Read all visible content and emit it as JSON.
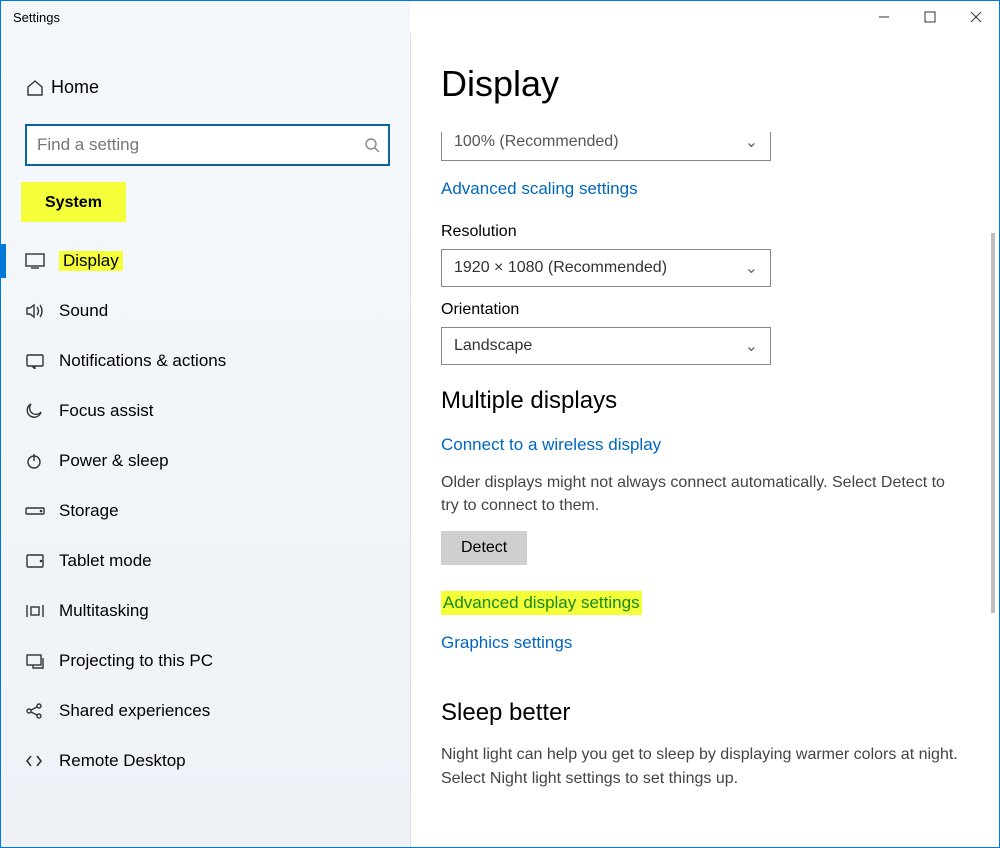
{
  "window": {
    "title": "Settings"
  },
  "sidebar": {
    "home": "Home",
    "search_placeholder": "Find a setting",
    "section": "System",
    "items": [
      {
        "label": "Display",
        "active": true,
        "highlighted": true
      },
      {
        "label": "Sound"
      },
      {
        "label": "Notifications & actions"
      },
      {
        "label": "Focus assist"
      },
      {
        "label": "Power & sleep"
      },
      {
        "label": "Storage"
      },
      {
        "label": "Tablet mode"
      },
      {
        "label": "Multitasking"
      },
      {
        "label": "Projecting to this PC"
      },
      {
        "label": "Shared experiences"
      },
      {
        "label": "Remote Desktop"
      }
    ]
  },
  "main": {
    "title": "Display",
    "scale_value": "100% (Recommended)",
    "scaling_link": "Advanced scaling settings",
    "resolution_label": "Resolution",
    "resolution_value": "1920 × 1080 (Recommended)",
    "orientation_label": "Orientation",
    "orientation_value": "Landscape",
    "multiple_heading": "Multiple displays",
    "wireless_link": "Connect to a wireless display",
    "detect_text": "Older displays might not always connect automatically. Select Detect to try to connect to them.",
    "detect_btn": "Detect",
    "adv_display_link": "Advanced display settings",
    "graphics_link": "Graphics settings",
    "sleep_heading": "Sleep better",
    "sleep_text": "Night light can help you get to sleep by displaying warmer colors at night. Select Night light settings to set things up."
  }
}
